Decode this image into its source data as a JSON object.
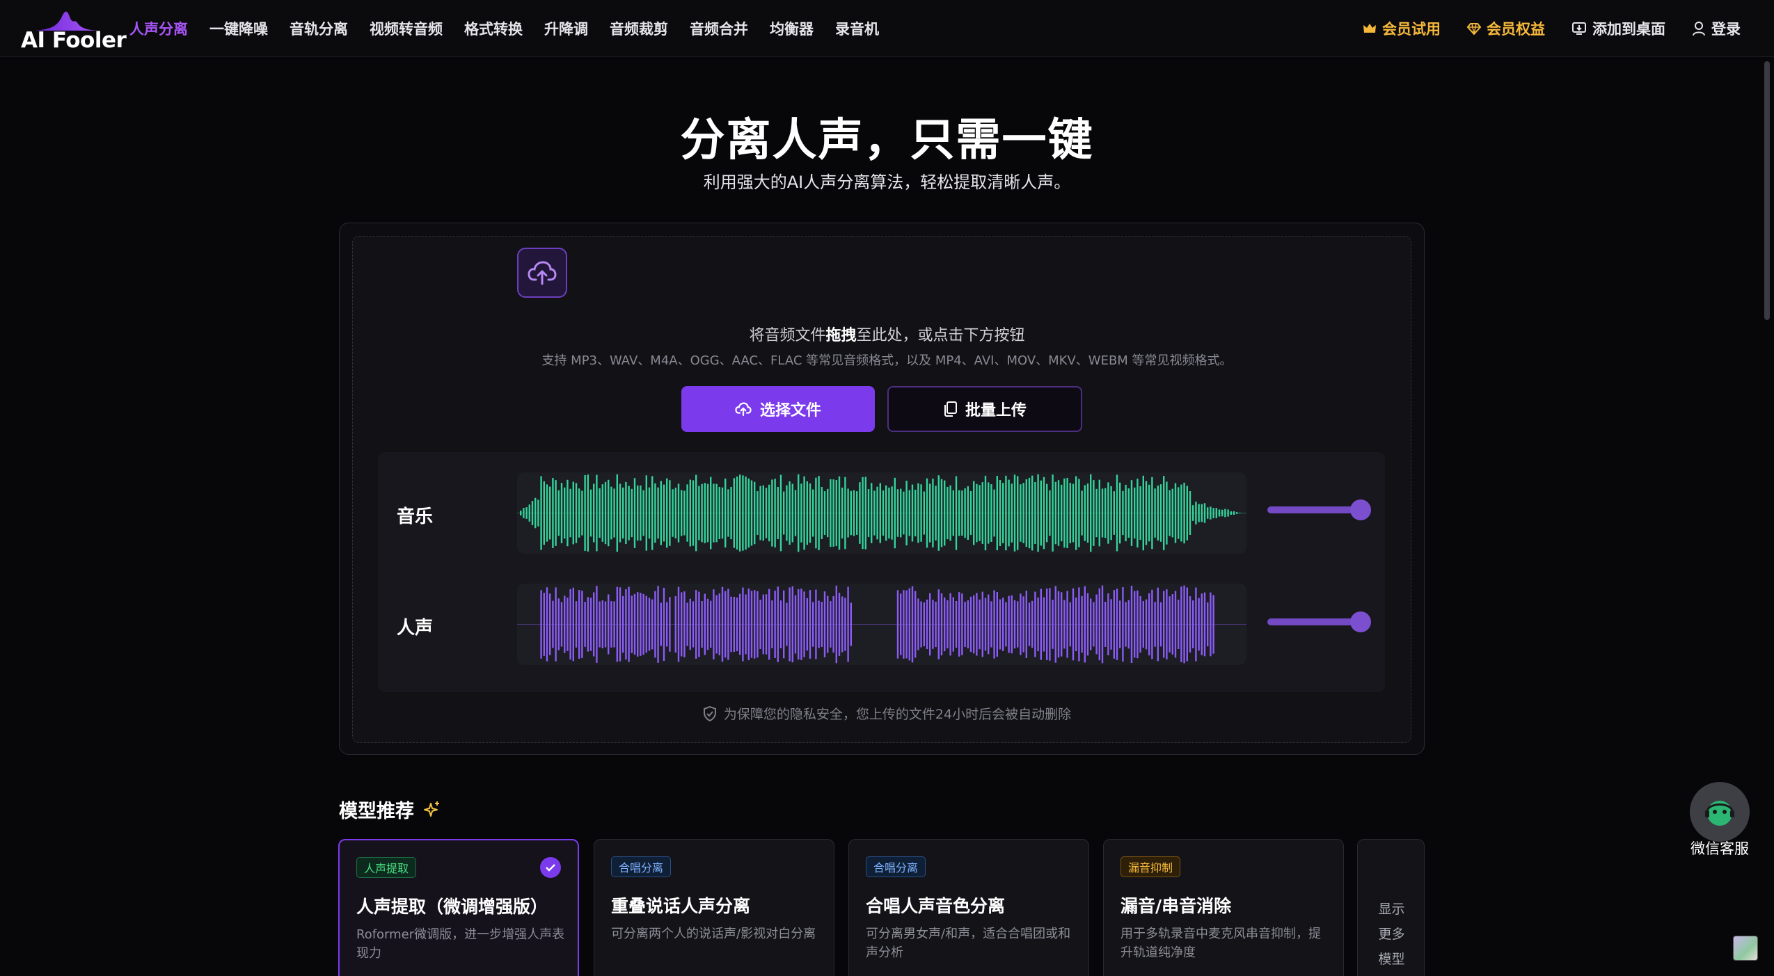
{
  "nav": {
    "logo_text": "AI Fooler",
    "links": [
      "人声分离",
      "一键降噪",
      "音轨分离",
      "视频转音频",
      "格式转换",
      "升降调",
      "音频裁剪",
      "音频合并",
      "均衡器",
      "录音机"
    ],
    "trial": "会员试用",
    "benefits": "会员权益",
    "add_desktop": "添加到桌面",
    "login": "登录"
  },
  "hero": {
    "title": "分离人声，只需一键",
    "subtitle": "利用强大的AI人声分离算法，轻松提取清晰人声。"
  },
  "upload": {
    "drop_prefix": "将音频文件",
    "drop_bold": "拖拽",
    "drop_suffix": "至此处，或点击下方按钮",
    "formats": "支持 MP3、WAV、M4A、OGG、AAC、FLAC 等常见音频格式，以及 MP4、AVI、MOV、MKV、WEBM 等常见视频格式。",
    "select_button": "选择文件",
    "batch_button": "批量上传",
    "privacy": "为保障您的隐私安全，您上传的文件24小时后会被自动删除"
  },
  "tracks": [
    {
      "label": "音乐",
      "color": "#34d399",
      "volume": 1.0
    },
    {
      "label": "人声",
      "color": "#8b5cf6",
      "volume": 1.0
    }
  ],
  "models": {
    "title": "模型推荐",
    "cards": [
      {
        "tag": "人声提取",
        "tag_color": "green",
        "title": "人声提取（微调增强版）",
        "desc": "Roformer微调版，进一步增强人声表现力",
        "selected": true
      },
      {
        "tag": "合唱分离",
        "tag_color": "blue",
        "title": "重叠说话人声分离",
        "desc": "可分离两个人的说话声/影视对白分离",
        "selected": false
      },
      {
        "tag": "合唱分离",
        "tag_color": "blue",
        "title": "合唱人声音色分离",
        "desc": "可分离男女声/和声，适合合唱团或和声分析",
        "selected": false
      },
      {
        "tag": "漏音抑制",
        "tag_color": "amber",
        "title": "漏音/串音消除",
        "desc": "用于多轨录音中麦克风串音抑制，提升轨道纯净度",
        "selected": false
      }
    ],
    "more": [
      "显示",
      "更多",
      "模型"
    ]
  },
  "support": {
    "label": "微信客服"
  }
}
